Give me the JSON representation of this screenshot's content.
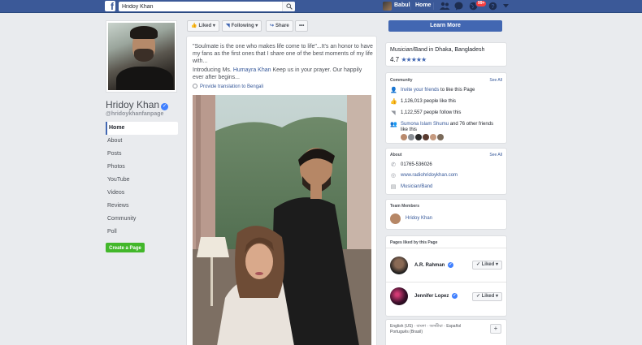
{
  "topbar": {
    "search_value": "Hridoy Khan",
    "user_name": "Babul",
    "home_label": "Home",
    "notification_count": "99+"
  },
  "left": {
    "page_name": "Hridoy Khan",
    "handle": "@hridoykhanfanpage",
    "nav": [
      "Home",
      "About",
      "Posts",
      "Photos",
      "YouTube",
      "Videos",
      "Reviews",
      "Community",
      "Poll"
    ],
    "create_page": "Create a Page"
  },
  "actions": {
    "liked": "Liked",
    "following": "Following",
    "share": "Share",
    "more": "•••"
  },
  "post": {
    "text1": "\"Soulmate is the one who makes life come to life\"...It's an honor to have my fans as the first ones that I share one of the best moments of my life with...",
    "text2_pre": "Introducing Ms. ",
    "text2_mention": "Humayra Khan",
    "text2_post": " Keep us in your prayer. Our happily ever after begins...",
    "translate": "Provide translation to Bengali"
  },
  "right": {
    "learn_more": "Learn More",
    "category": "Musician/Band in Dhaka, Bangladesh",
    "rating": "4.7",
    "stars": "★★★★★",
    "community": {
      "title": "Community",
      "see_all": "See All",
      "invite": "Invite your friends",
      "invite_rest": " to like this Page",
      "likes": "1,126,013 people like this",
      "follows": "1,122,557 people follow this",
      "friend_name": "Sumona Islam Shumu",
      "friends_rest": " and 76 other friends",
      "like_this": "like this"
    },
    "about": {
      "title": "About",
      "see_all": "See All",
      "phone": "01765-536026",
      "website": "www.radiohridoykhan.com",
      "category": "Musician/Band"
    },
    "team": {
      "title": "Team Members",
      "member": "Hridoy Khan"
    },
    "pages_liked": {
      "title": "Pages liked by this Page",
      "pages": [
        {
          "name": "A.R. Rahman",
          "button": "Liked"
        },
        {
          "name": "Jennifer Lopez",
          "button": "Liked"
        }
      ]
    },
    "languages": {
      "line1": "English (US) · বাংলা · অসমীয়া · Español",
      "line2": "Português (Brasil)",
      "add": "+"
    }
  },
  "colors": {
    "brand": "#3b5998",
    "link": "#365899",
    "button_blue": "#4267b2",
    "create_green": "#42b72a",
    "badge_red": "#fa3e3e"
  }
}
